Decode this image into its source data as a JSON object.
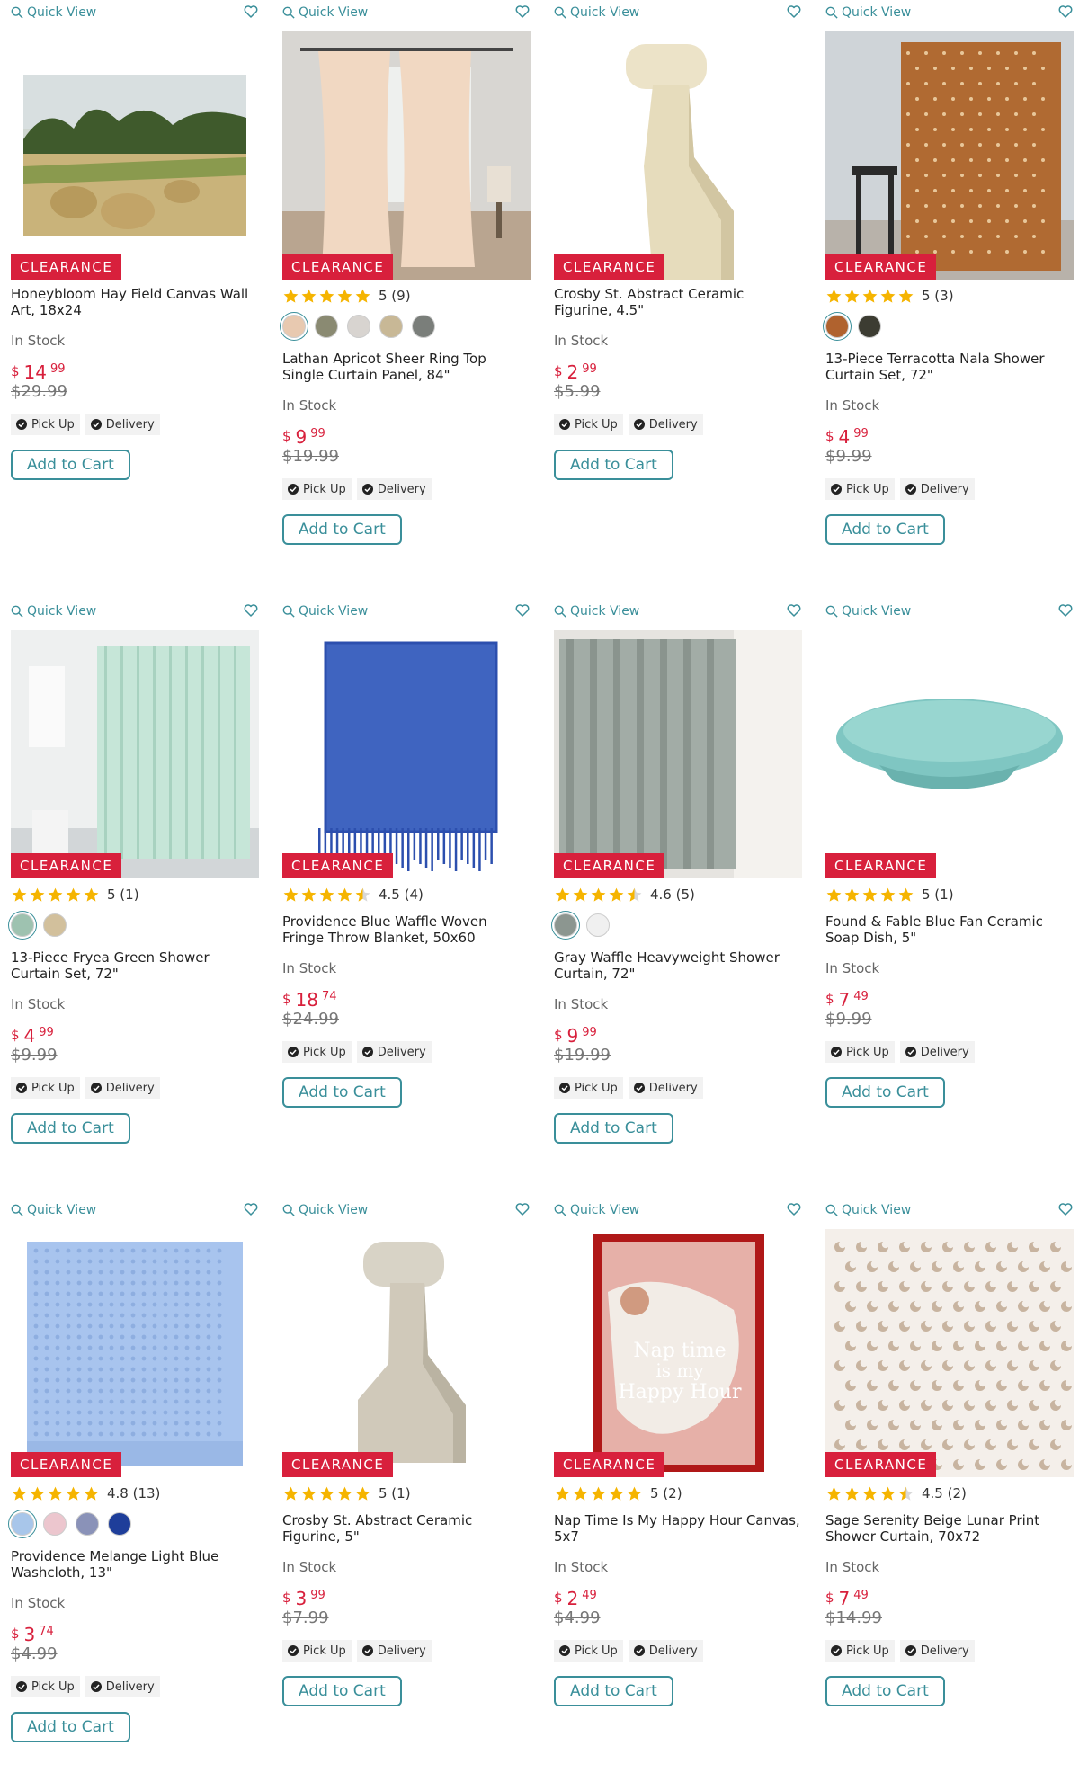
{
  "labels": {
    "quick_view": "Quick View",
    "clearance": "CLEARANCE",
    "pick_up": "Pick Up",
    "delivery": "Delivery",
    "add_to_cart": "Add to Cart",
    "currency": "$"
  },
  "colors": {
    "accent": "#3a8f9a",
    "clearance": "#d8203c",
    "star": "#f5b400"
  },
  "products": [
    {
      "title": "Honeybloom Hay Field Canvas Wall Art, 18x24",
      "stock": "In Stock",
      "price_dollars": "14",
      "price_cents": "99",
      "was": "$29.99",
      "rating": null,
      "rating_text": "",
      "swatches": [],
      "image": "landscape-painting"
    },
    {
      "title": "Lathan Apricot Sheer Ring Top Single Curtain Panel, 84\"",
      "stock": "In Stock",
      "price_dollars": "9",
      "price_cents": "99",
      "was": "$19.99",
      "rating": 5,
      "rating_text": "5 (9)",
      "swatches": [
        "#e8c9b0",
        "#8a8a72",
        "#d8d4d0",
        "#c8b896",
        "#7a7e7a"
      ],
      "image": "sheer-curtain"
    },
    {
      "title": "Crosby St. Abstract Ceramic Figurine, 4.5\"",
      "stock": "In Stock",
      "price_dollars": "2",
      "price_cents": "99",
      "was": "$5.99",
      "rating": null,
      "rating_text": "",
      "swatches": [],
      "image": "ceramic-figurine"
    },
    {
      "title": "13-Piece Terracotta Nala Shower Curtain Set, 72\"",
      "stock": "In Stock",
      "price_dollars": "4",
      "price_cents": "99",
      "was": "$9.99",
      "rating": 5,
      "rating_text": "5 (3)",
      "swatches": [
        "#b0622e",
        "#3c3c32"
      ],
      "image": "terracotta-curtain"
    },
    {
      "title": "13-Piece Fryea Green Shower Curtain Set, 72\"",
      "stock": "In Stock",
      "price_dollars": "4",
      "price_cents": "99",
      "was": "$9.99",
      "rating": 5,
      "rating_text": "5 (1)",
      "swatches": [
        "#9ec2b0",
        "#d2c09c"
      ],
      "image": "green-curtain"
    },
    {
      "title": "Providence Blue Waffle Woven Fringe Throw Blanket, 50x60",
      "stock": "In Stock",
      "price_dollars": "18",
      "price_cents": "74",
      "was": "$24.99",
      "rating": 4.5,
      "rating_text": "4.5 (4)",
      "swatches": [],
      "image": "blue-blanket"
    },
    {
      "title": "Gray Waffle Heavyweight Shower Curtain, 72\"",
      "stock": "In Stock",
      "price_dollars": "9",
      "price_cents": "99",
      "was": "$19.99",
      "rating": 4.5,
      "rating_text": "4.6 (5)",
      "swatches": [
        "#8c9690",
        "#f0f0f0"
      ],
      "image": "gray-curtain"
    },
    {
      "title": "Found & Fable Blue Fan Ceramic Soap Dish, 5\"",
      "stock": "In Stock",
      "price_dollars": "7",
      "price_cents": "49",
      "was": "$9.99",
      "rating": 5,
      "rating_text": "5 (1)",
      "swatches": [],
      "image": "soap-dish"
    },
    {
      "title": "Providence Melange Light Blue Washcloth, 13\"",
      "stock": "In Stock",
      "price_dollars": "3",
      "price_cents": "74",
      "was": "$4.99",
      "rating": 5,
      "rating_text": "4.8 (13)",
      "swatches": [
        "#a8c6ea",
        "#ecc6ce",
        "#8a92b8",
        "#1e3e9a"
      ],
      "image": "washcloth"
    },
    {
      "title": "Crosby St. Abstract Ceramic Figurine, 5\"",
      "stock": "In Stock",
      "price_dollars": "3",
      "price_cents": "99",
      "was": "$7.99",
      "rating": 5,
      "rating_text": "5 (1)",
      "swatches": [],
      "image": "ceramic-figurine-gray"
    },
    {
      "title": "Nap Time Is My Happy Hour Canvas, 5x7",
      "stock": "In Stock",
      "price_dollars": "2",
      "price_cents": "49",
      "was": "$4.99",
      "rating": 5,
      "rating_text": "5 (2)",
      "swatches": [],
      "image": "nap-canvas",
      "image_text": [
        "Nap time",
        "is my",
        "Happy Hour"
      ]
    },
    {
      "title": "Sage Serenity Beige Lunar Print Shower Curtain, 70x72",
      "stock": "In Stock",
      "price_dollars": "7",
      "price_cents": "49",
      "was": "$14.99",
      "rating": 4.5,
      "rating_text": "4.5 (2)",
      "swatches": [],
      "image": "lunar-curtain"
    }
  ]
}
